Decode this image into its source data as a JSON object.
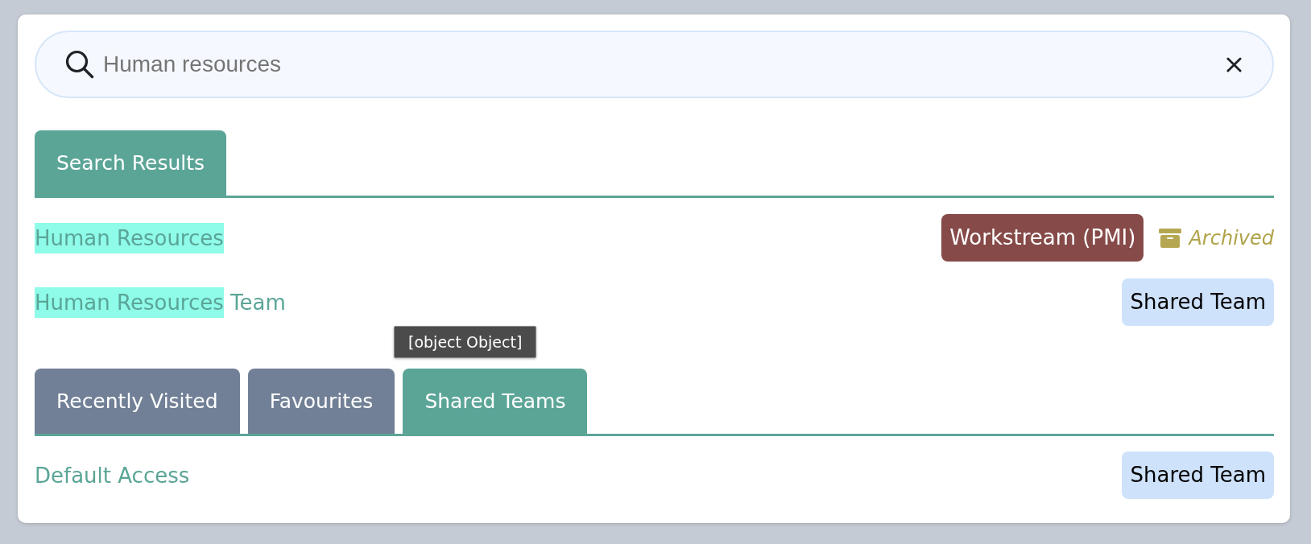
{
  "search": {
    "value": "Human resources"
  },
  "result_tabs": [
    {
      "label": "Search Results",
      "selected": true
    }
  ],
  "results": [
    {
      "segments": [
        {
          "text": "Human Resources",
          "highlighted": true
        }
      ],
      "badges": [
        {
          "label": "Workstream (PMI)",
          "kind": "workstream"
        }
      ],
      "archived": true,
      "archived_label": "Archived"
    },
    {
      "segments": [
        {
          "text": "Human Resources",
          "highlighted": true
        },
        {
          "text": " Team",
          "highlighted": false
        }
      ],
      "badges": [
        {
          "label": "Shared Team",
          "kind": "shared"
        }
      ],
      "archived": false
    }
  ],
  "tooltip": {
    "text": "[object Object]"
  },
  "tabs": [
    {
      "label": "Recently Visited",
      "selected": false
    },
    {
      "label": "Favourites",
      "selected": false
    },
    {
      "label": "Shared Teams",
      "selected": true
    }
  ],
  "list": [
    {
      "name": "Default Access",
      "badges": [
        {
          "label": "Shared Team",
          "kind": "shared"
        }
      ]
    }
  ]
}
